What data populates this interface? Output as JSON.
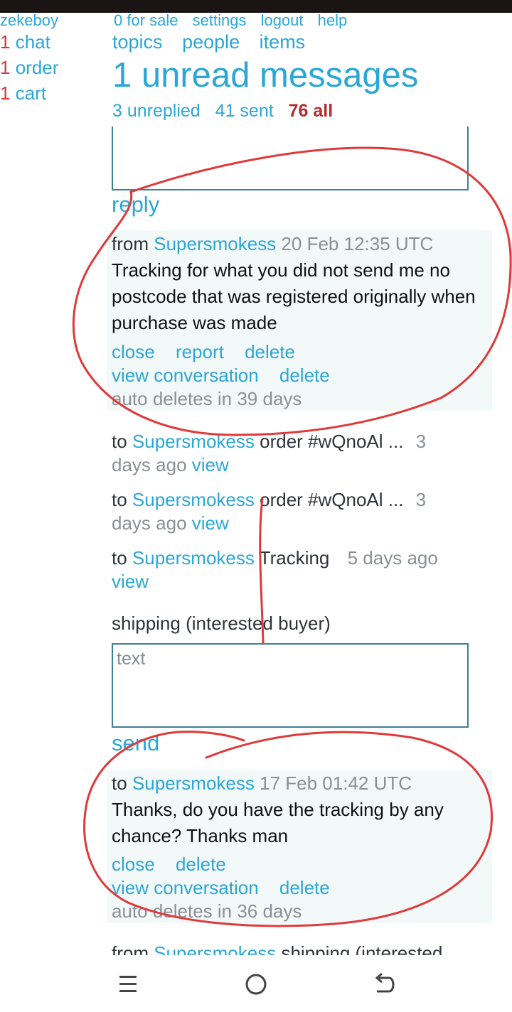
{
  "left_nav": {
    "username": "zekeboy",
    "items": [
      {
        "count": "1",
        "label": "chat"
      },
      {
        "count": "1",
        "label": "order"
      },
      {
        "count": "1",
        "label": "cart"
      }
    ]
  },
  "top_menu": [
    "0 for sale",
    "settings",
    "logout",
    "help"
  ],
  "section_menu": [
    "topics",
    "people",
    "items"
  ],
  "page_title": "1 unread messages",
  "filters": [
    "3 unreplied",
    "41 sent",
    "76 all"
  ],
  "reply_box": {
    "placeholder": "text",
    "button": "reply"
  },
  "message1": {
    "direction": "from",
    "user": "Supersmokess",
    "time": "20 Feb 12:35 UTC",
    "body": "Tracking for what you did not send me no postcode that was registered originally when purchase was made",
    "actions": [
      "close",
      "report",
      "delete"
    ],
    "actions2": [
      "view conversation",
      "delete"
    ],
    "auto_delete": "auto deletes in 39 days"
  },
  "threads": [
    {
      "direction": "to",
      "user": "Supersmokess",
      "subject": "order #wQnoAl ...",
      "age": "3 days ago",
      "link": "view"
    },
    {
      "direction": "to",
      "user": "Supersmokess",
      "subject": "order #wQnoAl ...",
      "age": "3 days ago",
      "link": "view"
    },
    {
      "direction": "to",
      "user": "Supersmokess",
      "subject": "Tracking",
      "age": "5 days ago",
      "link": "view"
    }
  ],
  "compose": {
    "label": "shipping (interested buyer)",
    "placeholder": "text",
    "button": "send"
  },
  "message2": {
    "direction": "to",
    "user": "Supersmokess",
    "time": "17 Feb 01:42 UTC",
    "body": "Thanks, do you have the tracking by any chance? Thanks man",
    "actions": [
      "close",
      "delete"
    ],
    "actions2": [
      "view conversation",
      "delete"
    ],
    "auto_delete": "auto deletes in 36 days"
  },
  "partial_row": {
    "direction": "from",
    "user": "Supersmokess",
    "subject": "shipping (interested"
  },
  "colors": {
    "accent": "#2aa7d6",
    "alert": "#d73838",
    "active_filter": "#b62b2b",
    "annotation": "#e0393a"
  },
  "android_nav": [
    "menu-icon",
    "home-icon",
    "back-icon"
  ]
}
